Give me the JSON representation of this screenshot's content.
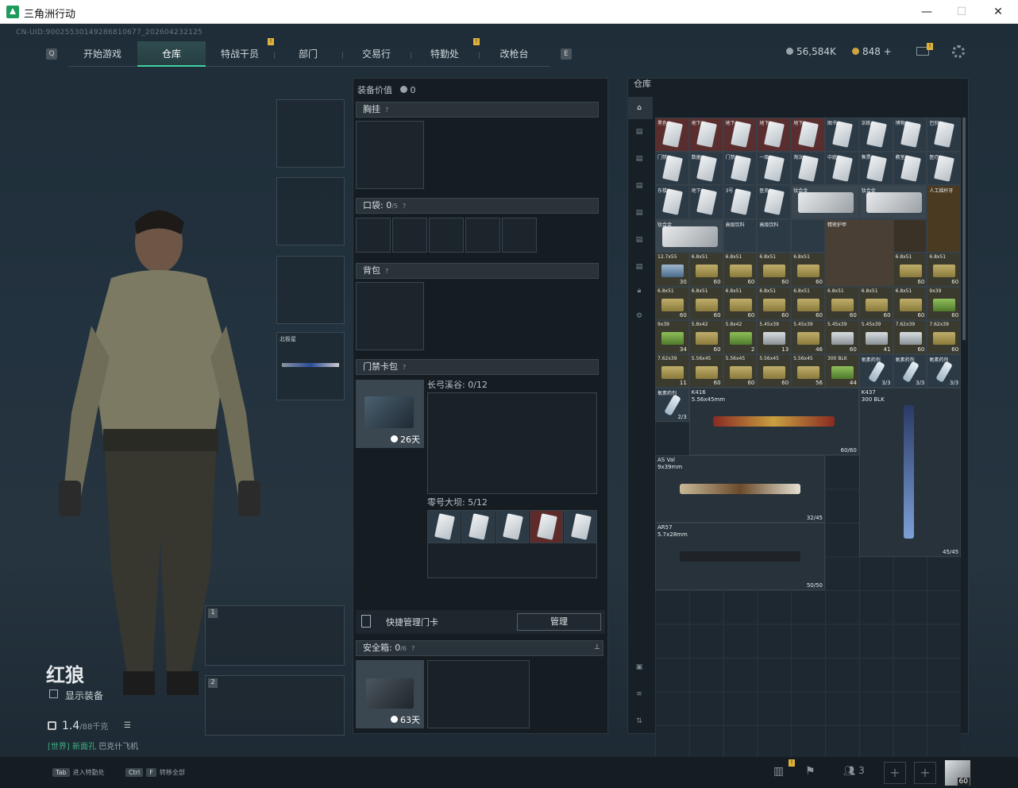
{
  "window": {
    "title": "三角洲行动",
    "min": "—",
    "max": "☐",
    "close": "✕"
  },
  "uid": "CN-UID:9002553014928​6810677_202604232125",
  "nav": {
    "tabs": [
      "开始游戏",
      "仓库",
      "特战干员",
      "部门",
      "交易行",
      "特勤处",
      "改枪台"
    ],
    "active": 1,
    "badge": "!"
  },
  "currency": {
    "money": "56,584K",
    "coin": "848 +"
  },
  "character": {
    "name": "红狼",
    "show_gear": "显示装备",
    "weight": "1.4",
    "weight_max": "/88千克",
    "chat_channel": "[世界]",
    "chat_user": "新面孔",
    "chat_text": "巴克什飞机"
  },
  "melee": {
    "name": "北极星"
  },
  "loadout": {
    "value_label": "装备价值",
    "value": "0",
    "chest_label": "胸挂",
    "pocket_label": "口袋:",
    "pocket_count": "0",
    "pocket_max": "/5",
    "backpack_label": "背包",
    "keycard_label": "门禁卡包",
    "keycard_days": "26天",
    "map1": "长弓溪谷: 0/12",
    "map2": "零号大坝: 5/12",
    "quick_manage": "快捷管理门卡",
    "manage_btn": "管理",
    "safe_label": "安全箱:",
    "safe_count": "0",
    "safe_max": "/6",
    "safe_days": "63天",
    "help": "?"
  },
  "inventory": {
    "title": "仓库",
    "ammo_rows": [
      [
        {
          "n": "12.7x55",
          "c": "30",
          "t": "blue"
        },
        {
          "n": "6.8x51",
          "c": "60"
        },
        {
          "n": "6.8x51",
          "c": "60"
        },
        {
          "n": "6.8x51",
          "c": "60"
        },
        {
          "n": "6.8x51",
          "c": "60"
        },
        {
          "n": "6.8x51",
          "c": "60"
        },
        {
          "n": "6.8x51",
          "c": "60"
        }
      ],
      [
        {
          "n": "6.8x51",
          "c": "60"
        },
        {
          "n": "6.8x51",
          "c": "60"
        },
        {
          "n": "6.8x51",
          "c": "60"
        },
        {
          "n": "6.8x51",
          "c": "60"
        },
        {
          "n": "6.8x51",
          "c": "60"
        },
        {
          "n": "6.8x51",
          "c": "60"
        },
        {
          "n": "6.8x51",
          "c": "60"
        },
        {
          "n": "6.8x51",
          "c": "60"
        },
        {
          "n": "9x39",
          "c": "60",
          "t": "green"
        }
      ],
      [
        {
          "n": "9x39",
          "c": "34",
          "t": "green"
        },
        {
          "n": "5.8x42",
          "c": "60"
        },
        {
          "n": "5.8x42",
          "c": "2",
          "t": "green"
        },
        {
          "n": "5.45x39",
          "c": "13",
          "t": "white"
        },
        {
          "n": "5.45x39",
          "c": "46"
        },
        {
          "n": "5.45x39",
          "c": "60",
          "t": "white"
        },
        {
          "n": "5.45x39",
          "c": "41",
          "t": "white"
        },
        {
          "n": "7.62x39",
          "c": "60",
          "t": "white"
        },
        {
          "n": "7.62x39",
          "c": "60"
        }
      ],
      [
        {
          "n": "7.62x39",
          "c": "11"
        },
        {
          "n": "5.56x45",
          "c": "60"
        },
        {
          "n": "5.56x45",
          "c": "60"
        },
        {
          "n": "5.56x45",
          "c": "60"
        },
        {
          "n": "5.56x45",
          "c": "56"
        },
        {
          "n": "300 BLK",
          "c": "44",
          "t": "green"
        },
        {
          "n": "氧素药剂",
          "c": "3/3",
          "t": "vial"
        },
        {
          "n": "氧素药剂",
          "c": "3/3",
          "t": "vial"
        },
        {
          "n": "氧素药剂",
          "c": "3/3",
          "t": "vial"
        }
      ]
    ],
    "misc": {
      "plate1": "钛合金",
      "plate2": "钛合金",
      "plate3": "钛合金",
      "drink1": "高级饮料",
      "drink2": "高级饮料",
      "bag": "精密护甲",
      "bag_count": "120",
      "toy": "人工摇杆牙",
      "vial_last": "氧素药剂",
      "vial_last_count": "2/3"
    },
    "guns": [
      {
        "name": "K416",
        "cal": "5.56x45mm",
        "ammo": "60/60"
      },
      {
        "name": "K437",
        "cal": "300 BLK",
        "ammo": "45/45"
      },
      {
        "name": "AS Val",
        "cal": "9x39mm",
        "ammo": "32/45"
      },
      {
        "name": "AR57",
        "cal": "5.7x28mm",
        "ammo": "50/50"
      }
    ],
    "card_labels": [
      "黑色",
      "地下",
      "地下",
      "地下",
      "地下",
      "图书",
      "训练",
      "博物",
      "巴别",
      "门禁",
      "数据",
      "门禁",
      "一级",
      "淘汰",
      "中庭",
      "售票",
      "教室",
      "医疗",
      "东楼",
      "地下",
      "3号",
      "医务"
    ]
  },
  "weapon_slots": [
    "1",
    "2"
  ],
  "bottom": {
    "tab_key": "Tab",
    "tab_text": "进入特勤处",
    "ctrl_key": "Ctrl",
    "f_key": "F",
    "ctrl_text": "转移全部",
    "friends": "3",
    "level": "60"
  },
  "colors": {
    "accent": "#3fd0a0",
    "badge": "#e0b23a",
    "red_slot": "#6a2a2a"
  }
}
